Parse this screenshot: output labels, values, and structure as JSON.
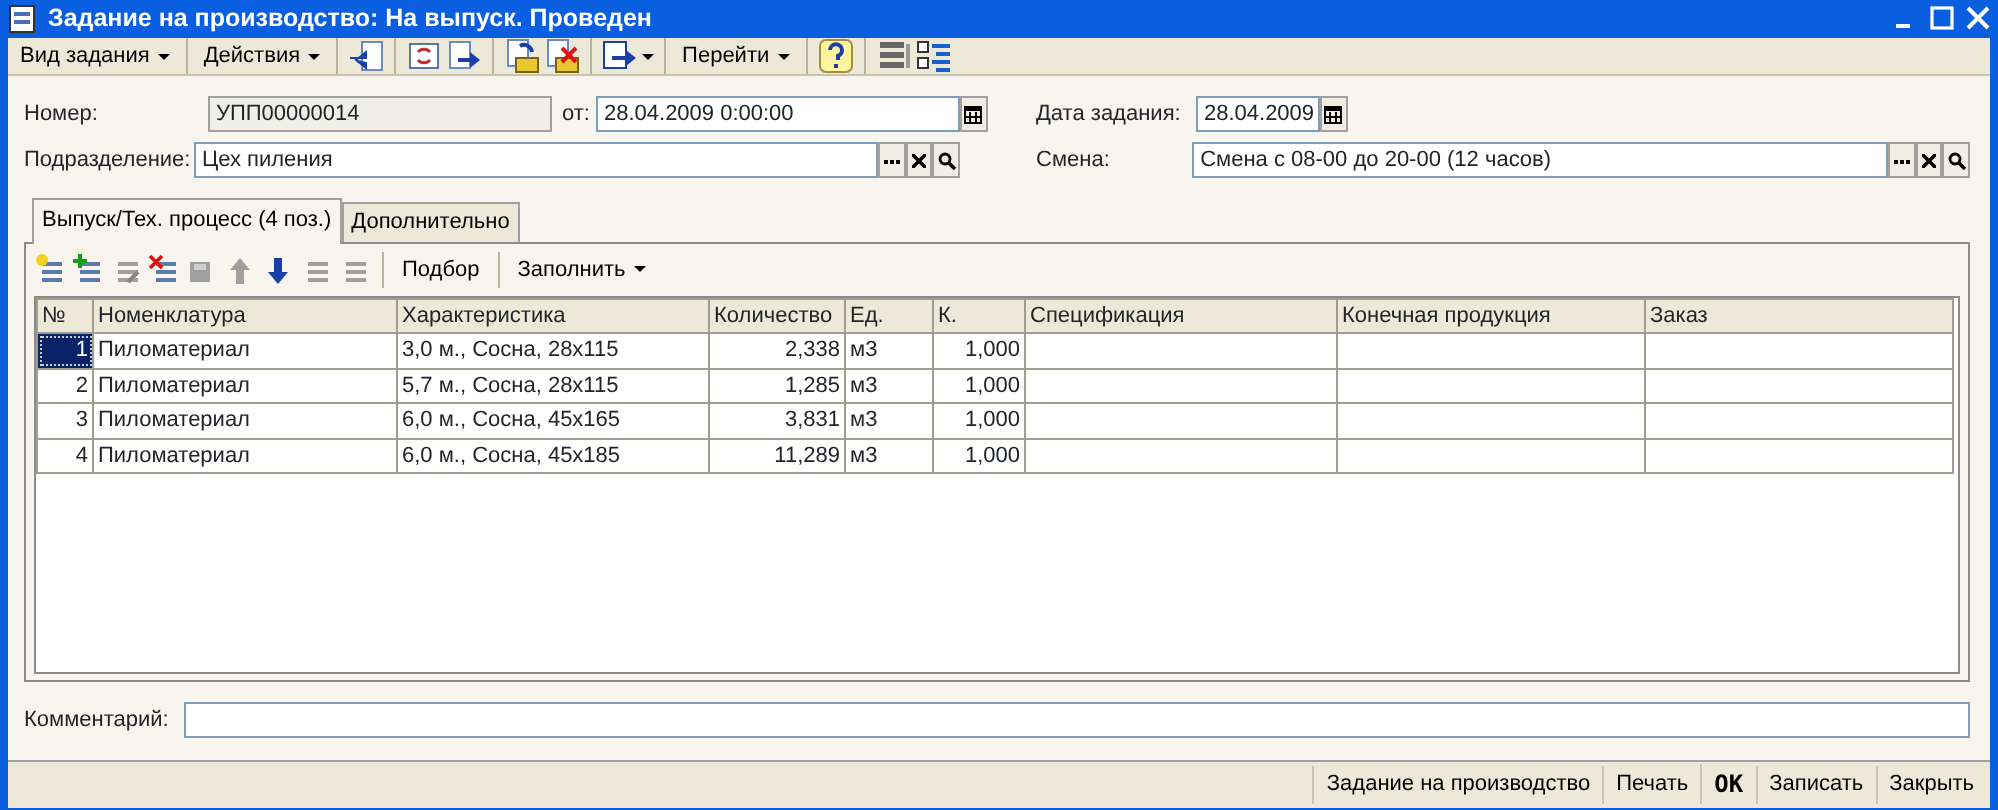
{
  "window": {
    "title": "Задание на производство: На выпуск. Проведен"
  },
  "toolbar": {
    "menus": [
      {
        "label": "Вид задания"
      },
      {
        "label": "Действия"
      },
      {
        "label": "Перейти"
      }
    ]
  },
  "header": {
    "number_label": "Номер:",
    "number": "УПП00000014",
    "from_label": "от:",
    "from": "28.04.2009  0:00:00",
    "task_date_label": "Дата задания:",
    "task_date": "28.04.2009",
    "department_label": "Подразделение:",
    "department": "Цех пиления",
    "shift_label": "Смена:",
    "shift": "Смена с 08-00 до 20-00 (12 часов)"
  },
  "tabs": [
    {
      "label": "Выпуск/Тех. процесс (4 поз.)",
      "selected": true
    },
    {
      "label": "Дополнительно",
      "selected": false
    }
  ],
  "table_toolbar": {
    "pick": "Подбор",
    "fill": "Заполнить"
  },
  "table": {
    "columns": [
      "№",
      "Номенклатура",
      "Характеристика",
      "Количество",
      "Ед.",
      "К.",
      "Спецификация",
      "Конечная продукция",
      "Заказ"
    ],
    "rows": [
      {
        "selected": true,
        "cells": [
          "1",
          "Пиломатериал",
          "3,0 м., Сосна, 28x115",
          "2,338",
          "м3",
          "1,000",
          "",
          "",
          ""
        ]
      },
      {
        "selected": false,
        "cells": [
          "2",
          "Пиломатериал",
          "5,7 м., Сосна, 28x115",
          "1,285",
          "м3",
          "1,000",
          "",
          "",
          ""
        ]
      },
      {
        "selected": false,
        "cells": [
          "3",
          "Пиломатериал",
          "6,0 м., Сосна, 45x165",
          "3,831",
          "м3",
          "1,000",
          "",
          "",
          ""
        ]
      },
      {
        "selected": false,
        "cells": [
          "4",
          "Пиломатериал",
          "6,0 м., Сосна, 45x185",
          "11,289",
          "м3",
          "1,000",
          "",
          "",
          ""
        ]
      }
    ]
  },
  "comment_label": "Комментарий:",
  "footer_buttons": [
    {
      "label": "Задание на производство",
      "default": false
    },
    {
      "label": "Печать",
      "default": false
    },
    {
      "label": "OK",
      "default": true
    },
    {
      "label": "Записать",
      "default": false
    },
    {
      "label": "Закрыть",
      "default": false
    }
  ]
}
